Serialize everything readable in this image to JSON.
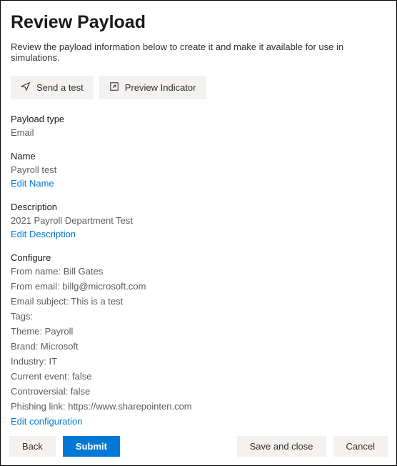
{
  "title": "Review Payload",
  "subtitle": "Review the payload information below to create it and make it available for use in simulations.",
  "actions": {
    "send_test": "Send a test",
    "preview_indicator": "Preview Indicator"
  },
  "sections": {
    "payload_type": {
      "label": "Payload type",
      "value": "Email"
    },
    "name": {
      "label": "Name",
      "value": "Payroll test",
      "edit": "Edit Name"
    },
    "description": {
      "label": "Description",
      "value": "2021 Payroll Department Test",
      "edit": "Edit Description"
    },
    "configure": {
      "label": "Configure",
      "items": [
        "From name: Bill Gates",
        "From email: billg@microsoft.com",
        "Email subject: This is a test",
        "Tags:",
        "Theme: Payroll",
        "Brand: Microsoft",
        "Industry: IT",
        "Current event: false",
        "Controversial: false",
        "Phishing link: https://www.sharepointen.com"
      ],
      "edit": "Edit configuration"
    }
  },
  "footer": {
    "back": "Back",
    "submit": "Submit",
    "save_close": "Save and close",
    "cancel": "Cancel"
  }
}
